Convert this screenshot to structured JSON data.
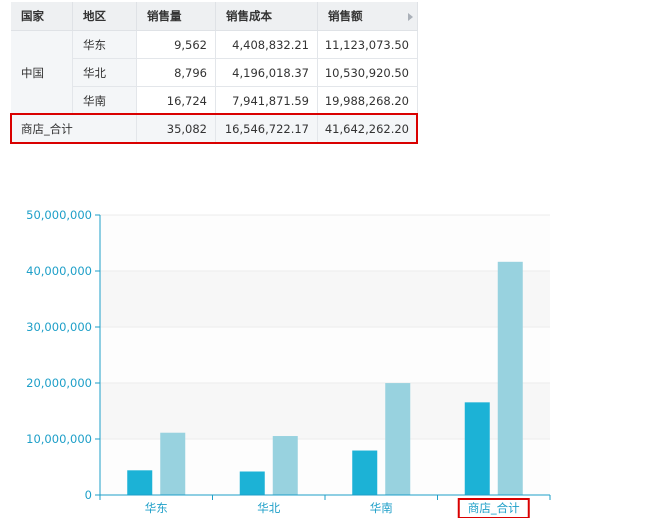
{
  "table": {
    "headers": [
      "国家",
      "地区",
      "销售量",
      "销售成本",
      "销售额"
    ],
    "country": "中国",
    "rows": [
      {
        "region": "华东",
        "qty": "9,562",
        "cost": "4,408,832.21",
        "sales": "11,123,073.50"
      },
      {
        "region": "华北",
        "qty": "8,796",
        "cost": "4,196,018.37",
        "sales": "10,530,920.50"
      },
      {
        "region": "华南",
        "qty": "16,724",
        "cost": "7,941,871.59",
        "sales": "19,988,268.20"
      }
    ],
    "total": {
      "label": "商店_合计",
      "qty": "35,082",
      "cost": "16,546,722.17",
      "sales": "41,642,262.20"
    }
  },
  "chart_data": {
    "type": "bar",
    "categories": [
      "华东",
      "华北",
      "华南",
      "商店_合计"
    ],
    "series": [
      {
        "values": [
          4408832.21,
          4196018.37,
          7941871.59,
          16546722.17
        ],
        "color": "#1cb2d6"
      },
      {
        "values": [
          11123073.5,
          10530920.5,
          19988268.2,
          41642262.2
        ],
        "color": "#98d2df"
      }
    ],
    "ylim": [
      0,
      50000000
    ],
    "yticks": [
      "50,000,000",
      "40,000,000",
      "30,000,000",
      "20,000,000",
      "10,000,000",
      "0"
    ],
    "xlabel": "",
    "ylabel": "",
    "title": "",
    "axis_color": "#1e9fc8",
    "highlight_category": "商店_合计"
  }
}
